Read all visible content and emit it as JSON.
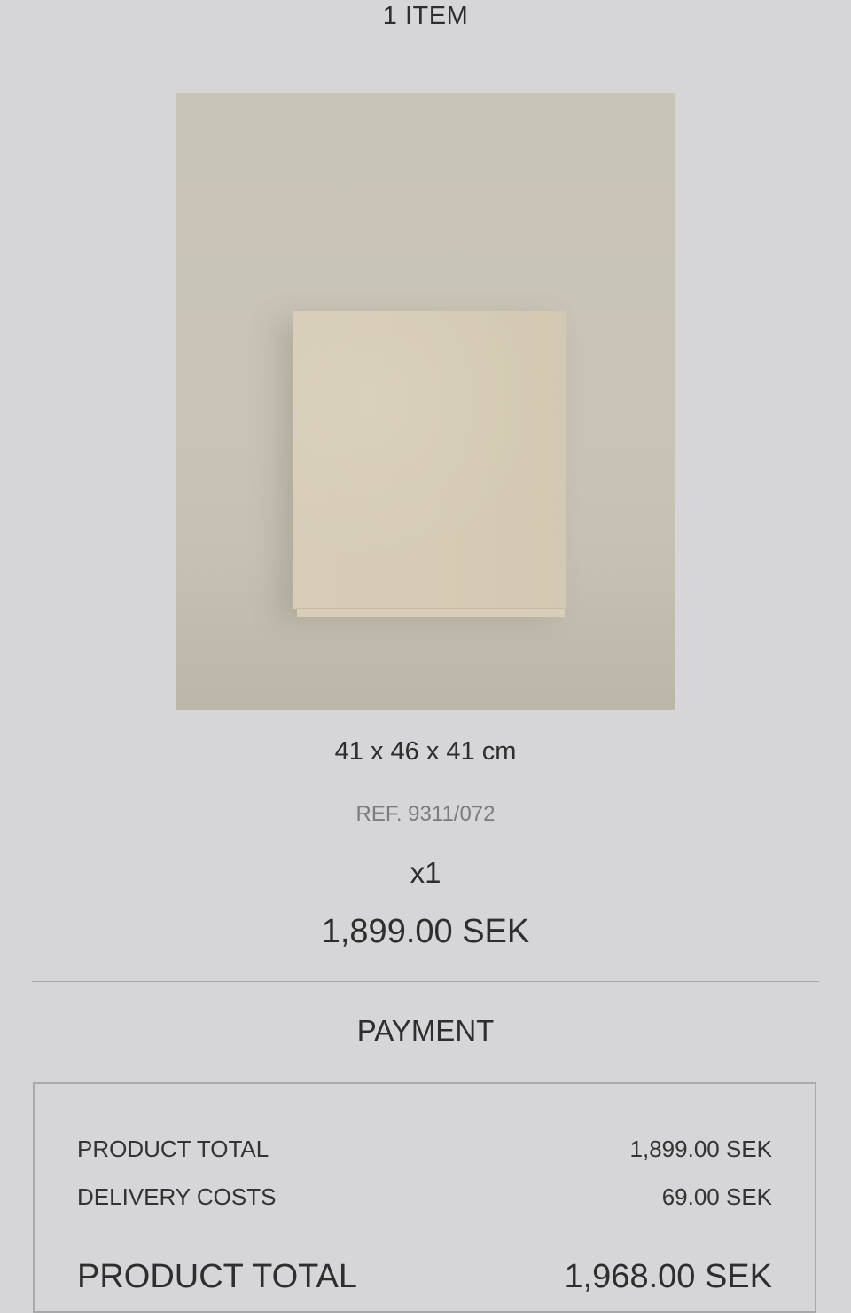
{
  "cart": {
    "item_count": "1 ITEM"
  },
  "product": {
    "image_icon": "product-photo-beige-cube",
    "dimensions": "41 x 46 x 41 cm",
    "ref": "REF. 9311/072",
    "quantity": "x1",
    "price": "1,899.00 SEK"
  },
  "payment": {
    "heading": "PAYMENT",
    "rows": [
      {
        "label": "PRODUCT TOTAL",
        "value": "1,899.00 SEK"
      },
      {
        "label": "DELIVERY COSTS",
        "value": "69.00 SEK"
      }
    ],
    "total": {
      "label": "PRODUCT TOTAL",
      "value": "1,968.00 SEK"
    }
  },
  "colors": {
    "background": "#d6d6d8",
    "text": "#2e2e2e",
    "muted": "#7c7c7e",
    "product_backdrop": "#c8c3b6",
    "product_cube": "#d6ccb5"
  }
}
